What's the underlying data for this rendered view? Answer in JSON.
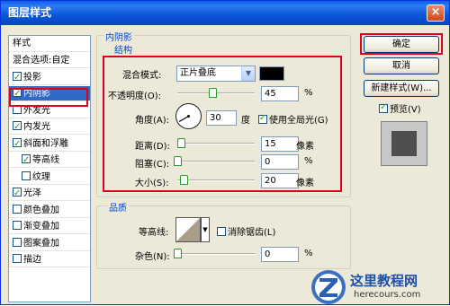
{
  "window": {
    "title": "图层样式",
    "close": "×"
  },
  "left_panel": {
    "header": "样式",
    "items": [
      {
        "label": "混合选项:自定",
        "checked": false,
        "selected": false
      },
      {
        "label": "投影",
        "checked": true,
        "selected": false
      },
      {
        "label": "内阴影",
        "checked": true,
        "selected": true
      },
      {
        "label": "外发光",
        "checked": false,
        "selected": false
      },
      {
        "label": "内发光",
        "checked": true,
        "selected": false
      },
      {
        "label": "斜面和浮雕",
        "checked": true,
        "selected": false
      },
      {
        "label": "等高线",
        "checked": true,
        "selected": false
      },
      {
        "label": "纹理",
        "checked": false,
        "selected": false
      },
      {
        "label": "光泽",
        "checked": true,
        "selected": false
      },
      {
        "label": "颜色叠加",
        "checked": false,
        "selected": false
      },
      {
        "label": "渐变叠加",
        "checked": false,
        "selected": false
      },
      {
        "label": "图案叠加",
        "checked": false,
        "selected": false
      },
      {
        "label": "描边",
        "checked": false,
        "selected": false
      }
    ]
  },
  "panel": {
    "title": "内阴影",
    "structure": {
      "label": "结构",
      "blend_mode_label": "混合模式:",
      "blend_mode_value": "正片叠底",
      "blend_color": "#000000",
      "opacity_label": "不透明度(O):",
      "opacity_value": "45",
      "opacity_fraction": 0.45,
      "opacity_unit": "%",
      "angle_label": "角度(A):",
      "angle_value": "30",
      "angle_unit": "度",
      "global_light_label": "使用全局光(G)",
      "global_light_checked": true,
      "distance_label": "距离(D):",
      "distance_value": "15",
      "distance_fraction": 0.05,
      "distance_unit": "像素",
      "choke_label": "阻塞(C):",
      "choke_value": "0",
      "choke_fraction": 0.0,
      "choke_unit": "%",
      "size_label": "大小(S):",
      "size_value": "20",
      "size_fraction": 0.08,
      "size_unit": "像素"
    },
    "quality": {
      "label": "品质",
      "contour_label": "等高线:",
      "antialias_label": "消除锯齿(L)",
      "antialias_checked": false,
      "noise_label": "杂色(N):",
      "noise_value": "0",
      "noise_fraction": 0.0,
      "noise_unit": "%"
    }
  },
  "buttons": {
    "ok": "确定",
    "cancel": "取消",
    "new_style": "新建样式(W)...",
    "preview_label": "预览(V)",
    "preview_checked": true
  },
  "watermark": {
    "brand": "这里教程网",
    "url": "herecours.com"
  },
  "colors": {
    "highlight": "#e0001a",
    "selection": "#316ac5",
    "titlebar": "#0a5fe8"
  }
}
